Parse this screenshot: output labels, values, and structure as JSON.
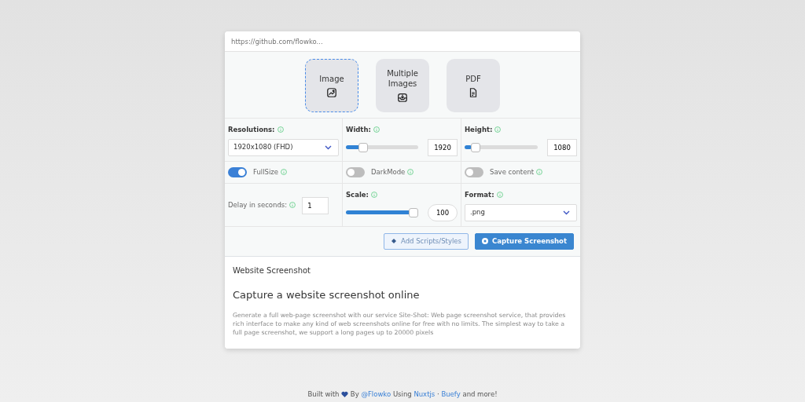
{
  "url_field": {
    "placeholder": "https://github.com/flowko..."
  },
  "modes": [
    {
      "label": "Image",
      "selected": true
    },
    {
      "label": "Multiple Images",
      "selected": false
    },
    {
      "label": "PDF",
      "selected": false
    }
  ],
  "resolution": {
    "label": "Resolutions:",
    "value": "1920x1080 (FHD)"
  },
  "sliders": [
    {
      "label": "Width:",
      "level": 0.2,
      "value": "1920"
    },
    {
      "label": "Height:",
      "level": 0.1,
      "value": "1080"
    }
  ],
  "toggles": [
    {
      "label": "FullSize",
      "on": true
    },
    {
      "label": "DarkMode",
      "on": false
    },
    {
      "label": "Save content",
      "on": false
    }
  ],
  "delay": {
    "label": "Delay in seconds:",
    "value": "1"
  },
  "scale": {
    "label": "Scale:",
    "level": 1,
    "value": "100"
  },
  "format": {
    "label": "Format:",
    "value": ".png"
  },
  "buttons": [
    {
      "label": "Add Scripts/Styles",
      "kind": "outline"
    },
    {
      "label": "Capture Screenshot",
      "kind": "primary"
    }
  ],
  "info": {
    "heading": "Website Screenshot",
    "title": "Capture a website screenshot online",
    "body": "Generate a full web-page screenshot with our service Site-Shot: Web page screenshot service, that provides rich interface to make any kind of web screenshots online for free with no limits. The simplest way to take a full page screenshot, we support a long pages up to 20000 pixels"
  },
  "footer": [
    {
      "kind": "text",
      "text": "Built with"
    },
    {
      "kind": "heart"
    },
    {
      "kind": "text",
      "text": "By"
    },
    {
      "kind": "link",
      "text": "@Flowko"
    },
    {
      "kind": "text",
      "text": "Using"
    },
    {
      "kind": "link",
      "text": "Nuxtjs"
    },
    {
      "kind": "text",
      "text": "·"
    },
    {
      "kind": "link",
      "text": "Buefy"
    },
    {
      "kind": "text",
      "text": "and more!"
    }
  ]
}
